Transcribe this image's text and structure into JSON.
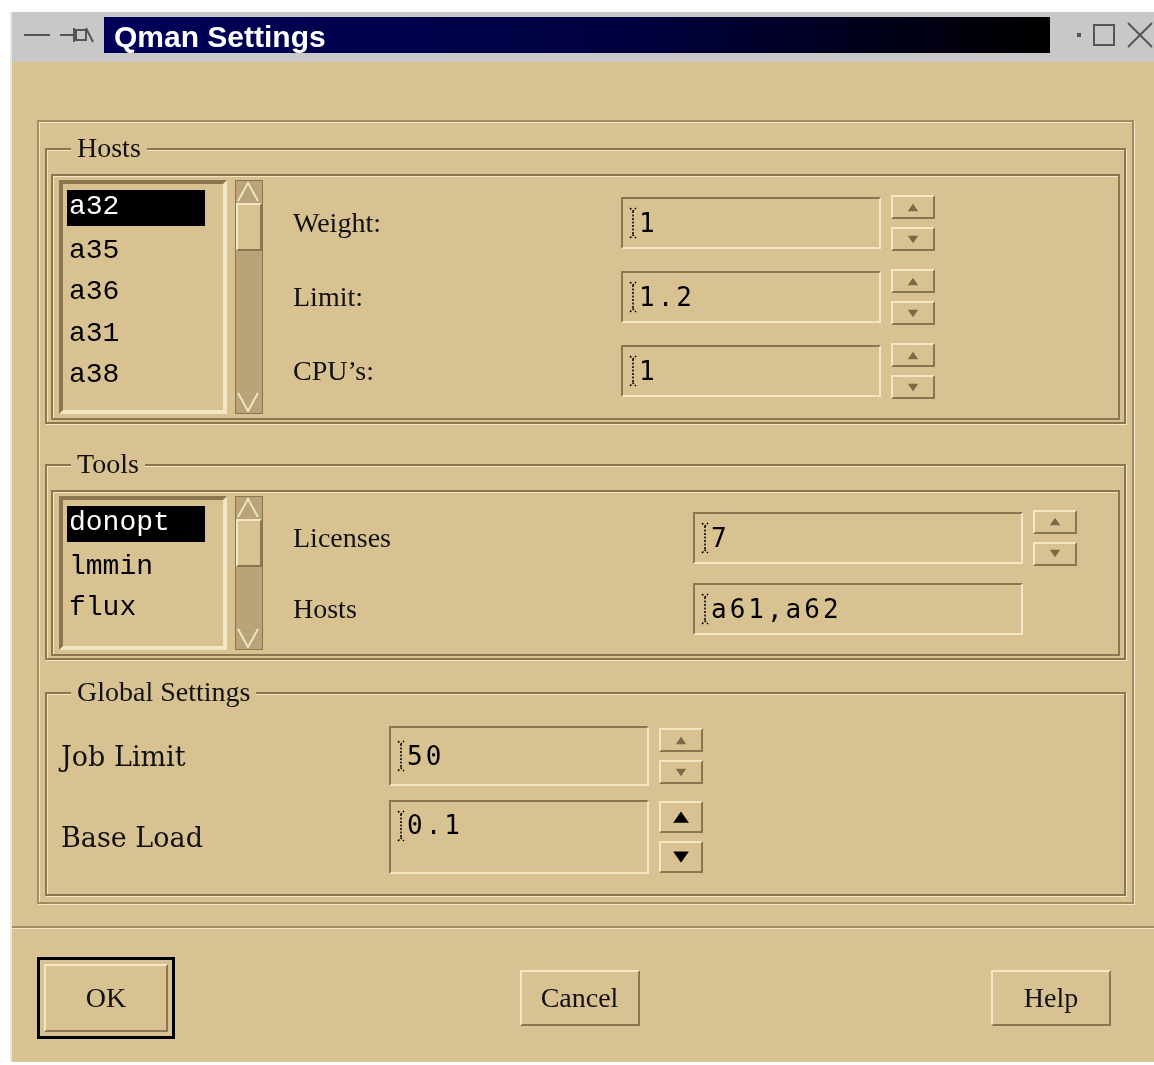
{
  "window": {
    "title": "Qman Settings"
  },
  "hosts": {
    "title": "Hosts",
    "items": [
      {
        "label": "a32",
        "selected": true
      },
      {
        "label": "a35",
        "selected": false
      },
      {
        "label": "a36",
        "selected": false
      },
      {
        "label": "a31",
        "selected": false
      },
      {
        "label": "a38",
        "selected": false
      }
    ],
    "fields": [
      {
        "label": "Weight:",
        "value": "1",
        "kind": "spin",
        "focused": false
      },
      {
        "label": "Limit:",
        "value": "1.2",
        "kind": "spin",
        "focused": false
      },
      {
        "label": "CPU’s:",
        "value": "1",
        "kind": "spin",
        "focused": false
      }
    ]
  },
  "tools": {
    "title": "Tools",
    "items": [
      {
        "label": "donopt",
        "selected": true
      },
      {
        "label": "lmmin",
        "selected": false
      },
      {
        "label": "flux",
        "selected": false
      }
    ],
    "fields": [
      {
        "label": "Licenses",
        "value": "7",
        "kind": "spin",
        "focused": false
      },
      {
        "label": "Hosts",
        "value": "a61,a62",
        "kind": "text"
      }
    ]
  },
  "global": {
    "title": "Global Settings",
    "fields": [
      {
        "label": "Job Limit",
        "value": "50",
        "kind": "spin",
        "focused": false
      },
      {
        "label": "Base Load",
        "value": "0.1",
        "kind": "spin",
        "focused": true
      }
    ]
  },
  "buttons": [
    {
      "label": "OK",
      "default": true
    },
    {
      "label": "Cancel",
      "default": false
    },
    {
      "label": "Help",
      "default": false
    }
  ]
}
